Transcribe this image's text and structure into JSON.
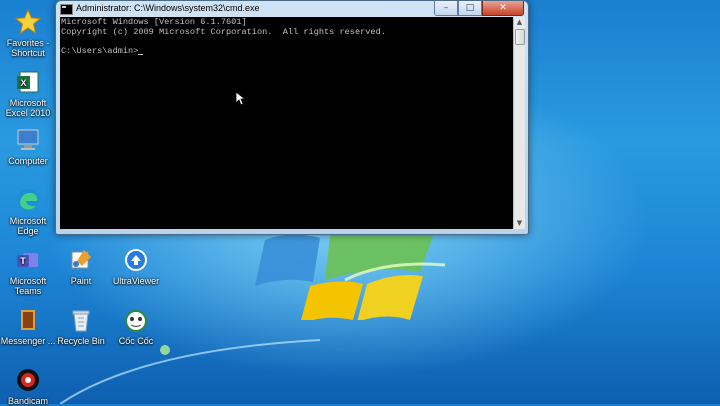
{
  "desktop": {
    "icons": [
      {
        "label": "Favorites - Shortcut"
      },
      {
        "label": "Microsoft Excel 2010"
      },
      {
        "label": "Computer"
      },
      {
        "label": "Microsoft Edge"
      },
      {
        "label": "Microsoft Teams"
      },
      {
        "label": "Paint"
      },
      {
        "label": "UltraViewer"
      },
      {
        "label": "Messenger ..."
      },
      {
        "label": "Recycle Bin"
      },
      {
        "label": "Cốc Cốc"
      },
      {
        "label": "Bandicam"
      }
    ]
  },
  "cmd_window": {
    "title": "Administrator: C:\\Windows\\system32\\cmd.exe",
    "minimize_glyph": "–",
    "maximize_glyph": "□",
    "close_glyph": "✕",
    "lines": [
      "Microsoft Windows [Version 6.1.7601]",
      "Copyright (c) 2009 Microsoft Corporation.  All rights reserved.",
      "",
      "C:\\Users\\admin>"
    ],
    "scroll_up_glyph": "▲",
    "scroll_down_glyph": "▼"
  },
  "colors": {
    "console_bg": "#000000",
    "console_text": "#c0c0c0",
    "desktop_bg": "#1d86d6"
  }
}
